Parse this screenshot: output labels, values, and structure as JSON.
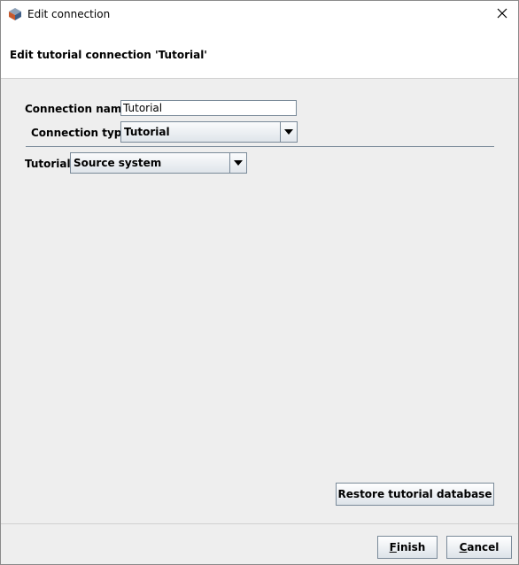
{
  "window": {
    "title": "Edit connection",
    "close_icon": "close-icon"
  },
  "header": {
    "text": "Edit tutorial connection 'Tutorial'"
  },
  "form": {
    "connection_name_label": "Connection name:",
    "connection_name_value": "Tutorial",
    "connection_type_label": "Connection type:",
    "connection_type_value": "Tutorial",
    "tutorial_label": "Tutorial:",
    "tutorial_value": "Source system"
  },
  "buttons": {
    "restore": "Restore tutorial database",
    "finish_first": "F",
    "finish_rest": "inish",
    "cancel_first": "C",
    "cancel_rest": "ancel"
  }
}
